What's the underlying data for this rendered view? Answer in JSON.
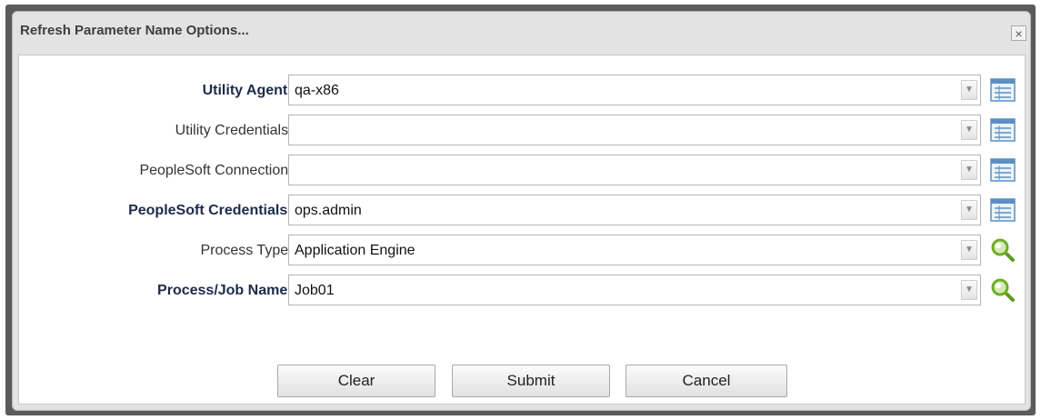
{
  "dialog": {
    "title": "Refresh Parameter Name Options...",
    "close_glyph": "×"
  },
  "fields": [
    {
      "label": "Utility Agent :",
      "value": "qa-x86",
      "bold": true,
      "icon": "list-icon"
    },
    {
      "label": "Utility Credentials :",
      "value": "",
      "bold": false,
      "icon": "list-icon"
    },
    {
      "label": "PeopleSoft Connection :",
      "value": "",
      "bold": false,
      "icon": "list-icon"
    },
    {
      "label": "PeopleSoft Credentials :",
      "value": "ops.admin",
      "bold": true,
      "icon": "list-icon"
    },
    {
      "label": "Process Type :",
      "value": "Application Engine",
      "bold": false,
      "icon": "search-icon"
    },
    {
      "label": "Process/Job Name :",
      "value": "Job01",
      "bold": true,
      "icon": "search-icon"
    }
  ],
  "buttons": {
    "clear": "Clear",
    "submit": "Submit",
    "cancel": "Cancel"
  },
  "colors": {
    "bold_label": "#1d2b4a",
    "icon_blue": "#5c8fc4",
    "icon_green": "#6fae2a"
  }
}
